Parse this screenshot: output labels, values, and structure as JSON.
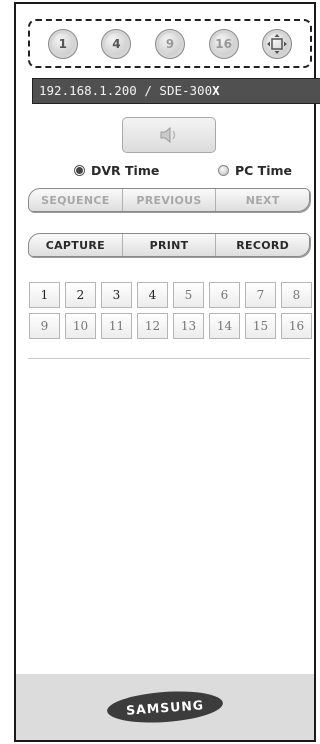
{
  "layout_buttons": [
    "1",
    "4",
    "9",
    "16"
  ],
  "address": {
    "ip": "192.168.1.200",
    "model_prefix": " / SDE-300",
    "model_suffix": "X"
  },
  "time_options": {
    "dvr": "DVR Time",
    "pc": "PC Time",
    "selected": "DVR Time"
  },
  "playback": {
    "sequence": "SEQUENCE",
    "previous": "PREVIOUS",
    "next": "NEXT"
  },
  "actions": {
    "capture": "CAPTURE",
    "print": "PRINT",
    "record": "RECORD"
  },
  "channels": [
    "1",
    "2",
    "3",
    "4",
    "5",
    "6",
    "7",
    "8",
    "9",
    "10",
    "11",
    "12",
    "13",
    "14",
    "15",
    "16"
  ],
  "brand": "SAMSUNG"
}
